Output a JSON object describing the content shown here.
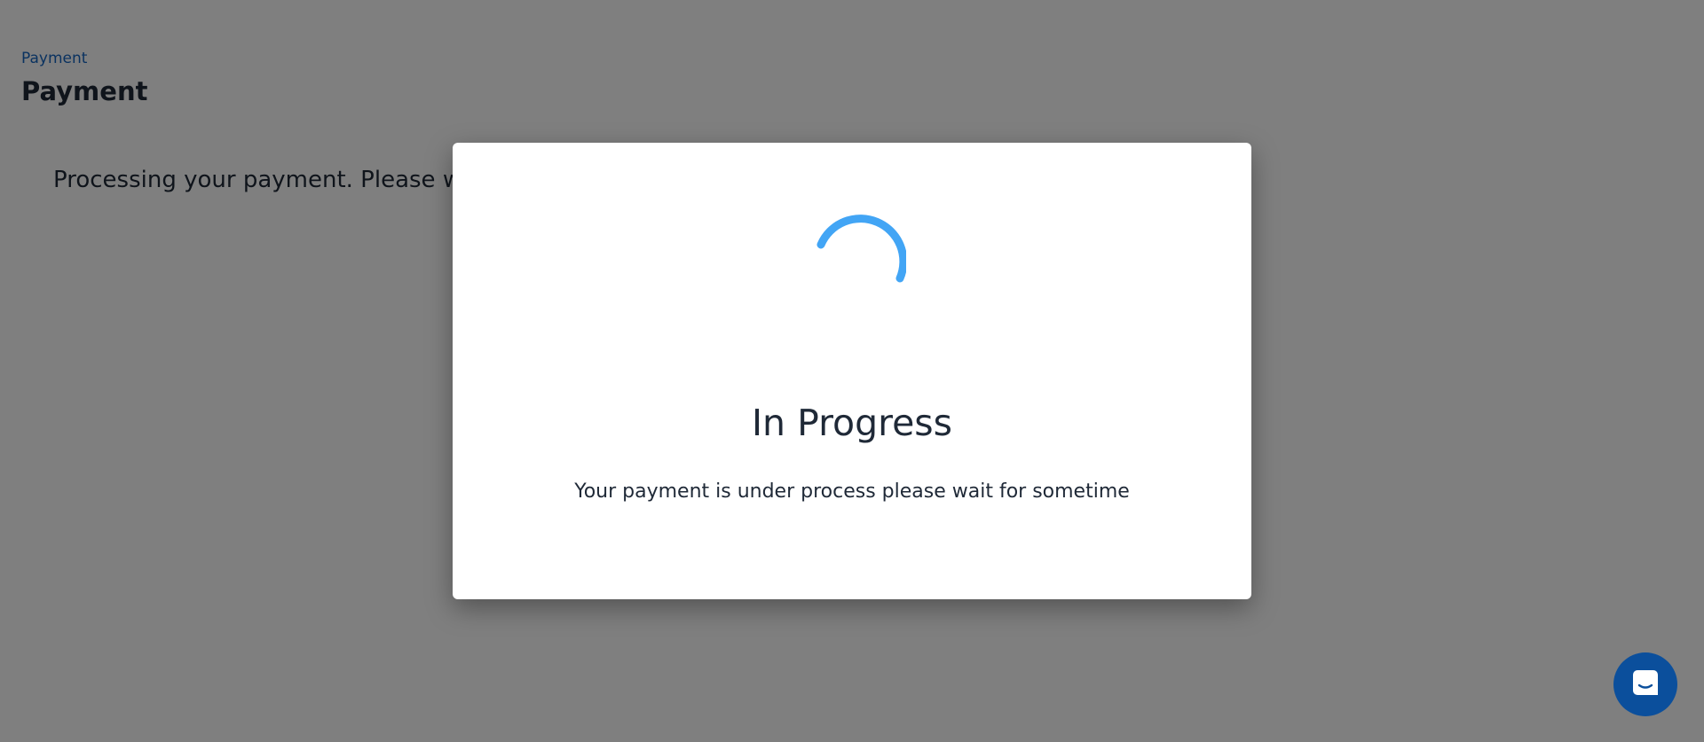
{
  "breadcrumb": {
    "label": "Payment"
  },
  "page": {
    "title": "Payment",
    "processing_text": "Processing your payment. Please wait"
  },
  "modal": {
    "spinner_icon": "loading-spinner-icon",
    "title": "In Progress",
    "message": "Your payment is under process please wait for sometime"
  },
  "chat_launcher": {
    "icon": "chat-icon"
  },
  "colors": {
    "accent": "#42a5f5",
    "link": "#1565c0",
    "chat_button": "#0b4f9c",
    "overlay": "rgba(0,0,0,0.5)"
  }
}
